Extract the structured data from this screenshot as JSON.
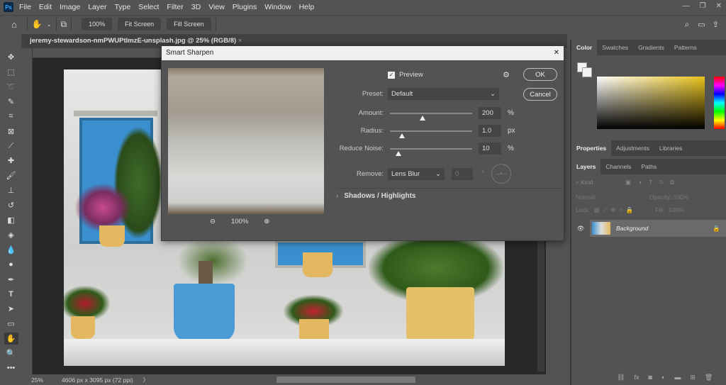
{
  "app": {
    "logo": "Ps",
    "menu": [
      "File",
      "Edit",
      "Image",
      "Layer",
      "Type",
      "Select",
      "Filter",
      "3D",
      "View",
      "Plugins",
      "Window",
      "Help"
    ]
  },
  "options": {
    "zoom_btn": "100%",
    "fit_btn": "Fit Screen",
    "fill_btn": "Fill Screen"
  },
  "document": {
    "tab_title": "jeremy-stewardson-nmPWUPtlmzE-unsplash.jpg @ 25% (RGB/8)",
    "tab_close": "×"
  },
  "status": {
    "zoom": "25%",
    "dimensions": "4606 px x 3095 px (72 ppi)",
    "arrow": "〉"
  },
  "dialog": {
    "title": "Smart Sharpen",
    "close": "✕",
    "preview_label": "Preview",
    "preview_checked": true,
    "ok": "OK",
    "cancel": "Cancel",
    "preset_label": "Preset:",
    "preset_value": "Default",
    "amount_label": "Amount:",
    "amount_value": "200",
    "amount_unit": "%",
    "amount_frac": 0.4,
    "radius_label": "Radius:",
    "radius_value": "1.0",
    "radius_unit": "px",
    "radius_frac": 0.15,
    "noise_label": "Reduce Noise:",
    "noise_value": "10",
    "noise_unit": "%",
    "noise_frac": 0.1,
    "remove_label": "Remove:",
    "remove_value": "Lens Blur",
    "angle_value": "0",
    "angle_unit": "°",
    "shadows_label": "Shadows / Highlights",
    "preview_zoom": "100%"
  },
  "panels": {
    "color_tabs": [
      "Color",
      "Swatches",
      "Gradients",
      "Patterns"
    ],
    "prop_tabs": [
      "Properties",
      "Adjustments",
      "Libraries"
    ],
    "layer_tabs": [
      "Layers",
      "Channels",
      "Paths"
    ],
    "kind_placeholder": "Kind",
    "blend_mode": "Normal",
    "opacity_label": "Opacity:",
    "opacity_value": "100%",
    "lock_label": "Lock:",
    "fill_label": "Fill:",
    "fill_value": "100%",
    "layer_name": "Background"
  },
  "colors": {
    "accent_yellow": "#e9c21a",
    "dialog_title_bg": "#f0f0f0"
  }
}
